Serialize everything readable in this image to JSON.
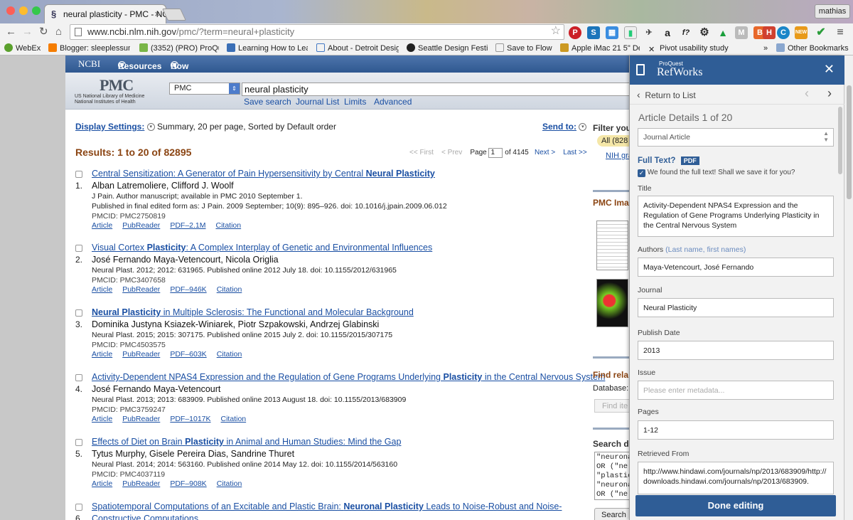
{
  "browser": {
    "tab_title": "neural plasticity - PMC - NC",
    "user": "mathias",
    "url_host": "www.ncbi.nlm.nih.gov",
    "url_path": "/pmc/?term=neural+plasticity",
    "bookmarks": [
      "WebEx",
      "Blogger: sleeplessun",
      "(3352) (PRO) ProQue",
      "Learning How to Lea",
      "About - Detroit Desig",
      "Seattle Design Festiv",
      "Save to Flow",
      "Apple iMac 21 5\" De",
      "Pivot usability study",
      "Other Bookmarks"
    ],
    "bookmarks_overflow": "»"
  },
  "ncbi": {
    "logo": "NCBI",
    "menu_resources": "Resources",
    "menu_howto": "How To",
    "pmc_logo": "PMC",
    "pmc_sub1": "US National Library of Medicine",
    "pmc_sub2": "National Institutes of Health",
    "db_select": "PMC",
    "search_value": "neural plasticity",
    "links": [
      "Save search",
      "Journal List",
      "Limits",
      "Advanced"
    ]
  },
  "display": {
    "label": "Display Settings:",
    "summary": "Summary, 20 per page, Sorted by Default order",
    "send_to": "Send to:"
  },
  "results_count": "Results: 1 to 20 of 82895",
  "pager": {
    "first": "<< First",
    "prev": "< Prev",
    "page_label": "Page",
    "page_value": "1",
    "of": "of 4145",
    "next": "Next >",
    "last": "Last >>"
  },
  "results": [
    {
      "num": "1.",
      "title_parts": [
        "Central Sensitization: A Generator of Pain Hypersensitivity by Central ",
        "Neural Plasticity",
        ""
      ],
      "authors": "Alban Latremoliere, Clifford J. Woolf",
      "lines": [
        "J Pain. Author manuscript; available in PMC 2010 September 1.",
        "Published in final edited form as: J Pain. 2009 September; 10(9): 895–926. doi: 10.1016/j.jpain.2009.06.012"
      ],
      "pmcid": "PMCID: PMC2750819",
      "links": [
        "Article",
        "PubReader",
        "PDF–2.1M",
        "Citation"
      ]
    },
    {
      "num": "2.",
      "title_parts": [
        "Visual Cortex ",
        "Plasticity",
        ": A Complex Interplay of Genetic and Environmental Influences"
      ],
      "authors": "José Fernando Maya-Vetencourt, Nicola Origlia",
      "lines": [
        "Neural Plast. 2012; 2012: 631965. Published online 2012 July 18. doi: 10.1155/2012/631965"
      ],
      "pmcid": "PMCID: PMC3407658",
      "links": [
        "Article",
        "PubReader",
        "PDF–946K",
        "Citation"
      ]
    },
    {
      "num": "3.",
      "title_parts": [
        "",
        "Neural Plasticity",
        " in Multiple Sclerosis: The Functional and Molecular Background"
      ],
      "authors": "Dominika Justyna Ksiazek-Winiarek, Piotr Szpakowski, Andrzej Glabinski",
      "lines": [
        "Neural Plast. 2015; 2015: 307175. Published online 2015 July 2. doi: 10.1155/2015/307175"
      ],
      "pmcid": "PMCID: PMC4503575",
      "links": [
        "Article",
        "PubReader",
        "PDF–603K",
        "Citation"
      ]
    },
    {
      "num": "4.",
      "title_parts": [
        "Activity-Dependent NPAS4 Expression and the Regulation of Gene Programs Underlying ",
        "Plasticity",
        " in the Central Nervous System"
      ],
      "authors": "José Fernando Maya-Vetencourt",
      "lines": [
        "Neural Plast. 2013; 2013: 683909. Published online 2013 August 18. doi: 10.1155/2013/683909"
      ],
      "pmcid": "PMCID: PMC3759247",
      "links": [
        "Article",
        "PubReader",
        "PDF–1017K",
        "Citation"
      ]
    },
    {
      "num": "5.",
      "title_parts": [
        "Effects of Diet on Brain ",
        "Plasticity",
        " in Animal and Human Studies: Mind the Gap"
      ],
      "authors": "Tytus Murphy, Gisele Pereira Dias, Sandrine Thuret",
      "lines": [
        "Neural Plast. 2014; 2014: 563160. Published online 2014 May 12. doi: 10.1155/2014/563160"
      ],
      "pmcid": "PMCID: PMC4037119",
      "links": [
        "Article",
        "PubReader",
        "PDF–908K",
        "Citation"
      ]
    },
    {
      "num": "6.",
      "title_parts": [
        "Spatiotemporal Computations of an Excitable and Plastic Brain: ",
        "Neuronal Plasticity",
        " Leads to Noise-Robust and Noise-"
      ],
      "title_line2": "Constructive Computations",
      "authors": "",
      "lines": [],
      "pmcid": "",
      "links": []
    }
  ],
  "right_column": {
    "filter": "Filter you",
    "all": "All (828",
    "nih": "NIH gra",
    "pmc_images": "PMC Ima",
    "find_related": "Find rela",
    "database": "Database:",
    "find_items": "Find ite",
    "search_details": "Search d",
    "query_lines": [
      "\"neurona",
      "OR (\"ne",
      "\"plastic",
      "\"neurona",
      "OR (\"ne"
    ],
    "search_btn": "Search"
  },
  "refworks": {
    "brand_small": "ProQuest",
    "brand": "RefWorks",
    "back": "Return to List",
    "details_title": "Article Details 1 of 20",
    "ref_type": "Journal Article",
    "full_text_label": "Full Text?",
    "pdf_badge": "PDF",
    "save_prompt": "We found the full text! Shall we save it for you?",
    "title_label": "Title",
    "title_value": "Activity-Dependent NPAS4 Expression and the Regulation of Gene Programs Underlying Plasticity in the Central Nervous System",
    "authors_label": "Authors",
    "authors_hint": "(Last name, first names)",
    "authors_value": "Maya-Vetencourt, José Fernando",
    "journal_label": "Journal",
    "journal_value": "Neural Plasticity",
    "date_label": "Publish Date",
    "date_value": "2013",
    "issue_label": "Issue",
    "issue_placeholder": "Please enter metadata...",
    "pages_label": "Pages",
    "pages_value": "1-12",
    "retrieved_label": "Retrieved From",
    "retrieved_value": "http://www.hindawi.com/journals/np/2013/683909/http://downloads.hindawi.com/journals/np/2013/683909.",
    "done_button": "Done editing"
  }
}
